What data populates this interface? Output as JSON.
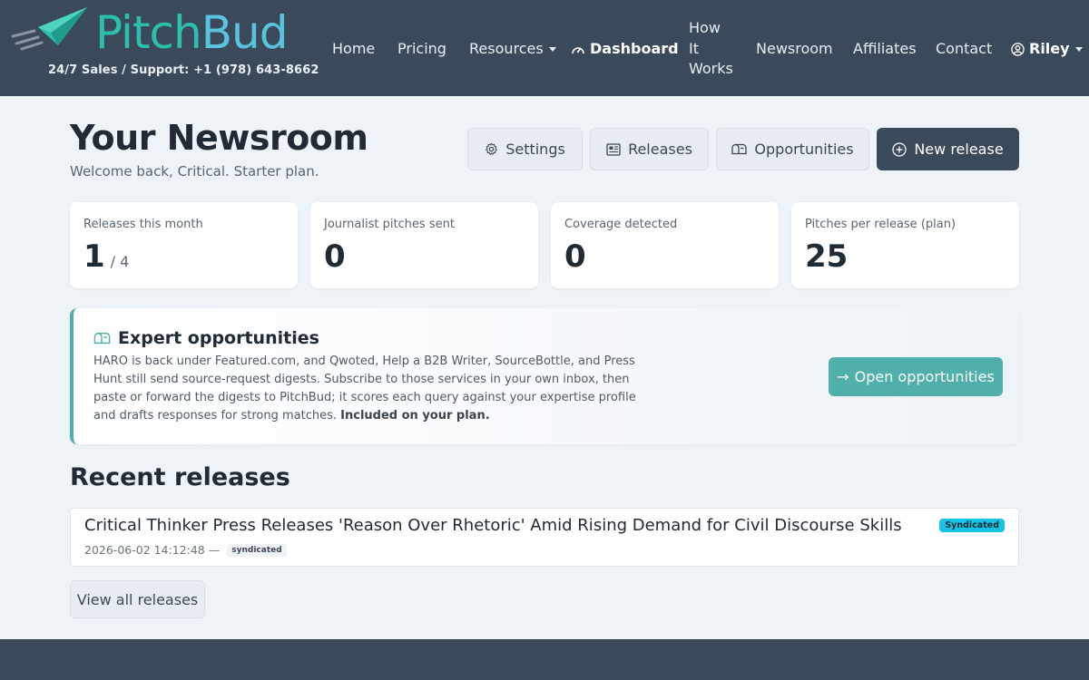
{
  "brand": {
    "name_part1": "Pitch",
    "name_part2": "Bud",
    "support": "24/7 Sales / Support: +1 (978) 643-8662",
    "colors": {
      "primary": "#2bbfae",
      "secondary": "#59c3de"
    }
  },
  "nav": {
    "home": "Home",
    "pricing": "Pricing",
    "resources": "Resources",
    "dashboard": "Dashboard",
    "how_line1": "How",
    "how_line2": "It",
    "how_line3": "Works",
    "newsroom": "Newsroom",
    "affiliates": "Affiliates",
    "contact": "Contact",
    "user": "Riley"
  },
  "header": {
    "title": "Your Newsroom",
    "subtitle": "Welcome back, Critical. Starter plan."
  },
  "actions": {
    "settings": "Settings",
    "releases": "Releases",
    "opportunities": "Opportunities",
    "new_release": "New release"
  },
  "stats": [
    {
      "label": "Releases this month",
      "value": "1",
      "suffix": "/ 4"
    },
    {
      "label": "Journalist pitches sent",
      "value": "0"
    },
    {
      "label": "Coverage detected",
      "value": "0"
    },
    {
      "label": "Pitches per release (plan)",
      "value": "25"
    }
  ],
  "callout": {
    "title": "Expert opportunities",
    "body": "HARO is back under Featured.com, and Qwoted, Help a B2B Writer, SourceBottle, and Press Hunt still send source-request digests. Subscribe to those services in your own inbox, then paste or forward the digests to PitchBud; it scores each query against your expertise profile and drafts responses for strong matches.",
    "body_bold": "Included on your plan.",
    "button": "Open opportunities",
    "accent": "#4fb0ab"
  },
  "recent": {
    "title": "Recent releases",
    "items": [
      {
        "title": "Critical Thinker Press Releases 'Reason Over Rhetoric' Amid Rising Demand for Civil Discourse Skills",
        "timestamp": "2026-06-02 14:12:48",
        "separator": "—",
        "status": "syndicated",
        "badge": "Syndicated"
      }
    ],
    "view_all": "View all releases"
  }
}
